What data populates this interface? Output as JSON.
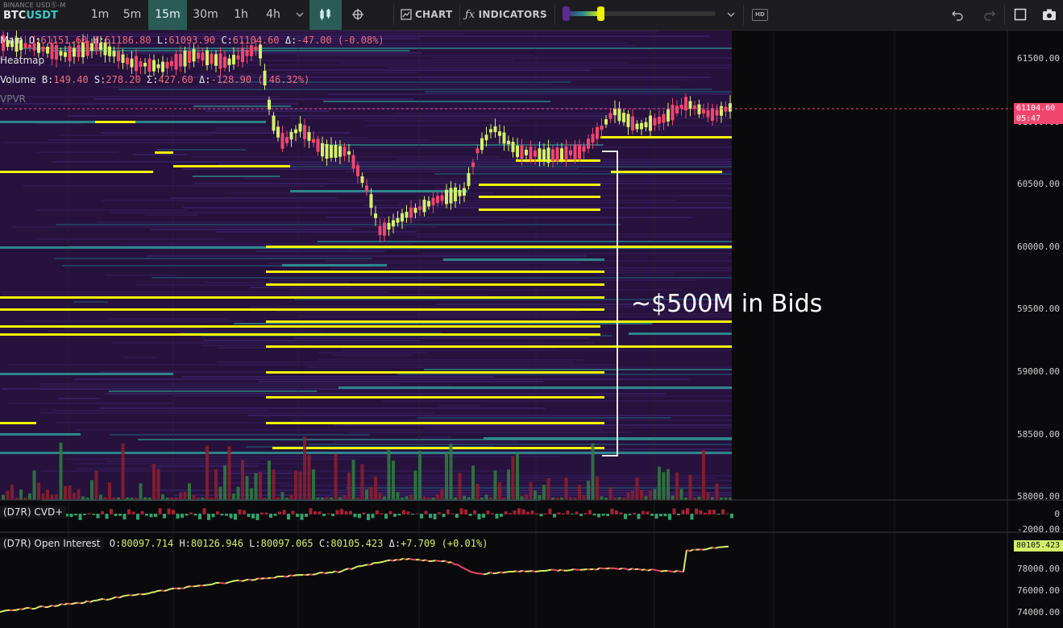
{
  "toolbar": {
    "exchange": "BINANCE USDⓈ-M",
    "pair_base": "BTC",
    "pair_quote": "USDT",
    "timeframes": [
      "1m",
      "5m",
      "15m",
      "30m",
      "1h",
      "4h"
    ],
    "active_timeframe": "15m",
    "chart_label": "CHART",
    "indicators_label": "INDICATORS",
    "hd_label": "HD",
    "icons": [
      "chevron-down-icon",
      "candles-icon",
      "crosshair-icon",
      "chart-icon",
      "fx-icon",
      "chevron-down-icon",
      "undo-icon",
      "redo-icon",
      "square-icon",
      "camera-icon"
    ]
  },
  "main_pane": {
    "label": "Main",
    "ohlc": {
      "O": "61151.60",
      "H": "61186.80",
      "L": "61093.90",
      "C": "61104.60",
      "delta": "-47.00 (-0.08%)"
    },
    "heatmap_label": "Heatmap",
    "volume_label": "Volume",
    "volume": {
      "B": "149.40",
      "S": "278.20",
      "sum": "427.60",
      "delta": "-128.90 (-46.32%)"
    },
    "vpvr_label": "VPVR",
    "price_axis": [
      "61500.00",
      "61000.00",
      "60500.00",
      "60000.00",
      "59500.00",
      "59000.00",
      "58500.00",
      "58000.00"
    ],
    "last_price": "61104.60",
    "countdown": "05:47",
    "annotation": "~$500M in Bids"
  },
  "cvd_pane": {
    "label": "(D7R) CVD+",
    "axis": [
      "0",
      "-2000.00"
    ]
  },
  "oi_pane": {
    "label": "(D7R) Open Interest",
    "ohlc": {
      "O": "80097.714",
      "H": "80126.946",
      "L": "80097.065",
      "C": "80105.423",
      "delta": "+7.709 (+0.01%)"
    },
    "axis": [
      "78000.00",
      "76000.00",
      "74000.00"
    ],
    "last_value": "80105.423"
  },
  "colors": {
    "up": "#d4f06a",
    "down": "#f0466e",
    "wall": "#f3f300",
    "heat_bg": "#26123d",
    "teal": "#2fa39b"
  }
}
